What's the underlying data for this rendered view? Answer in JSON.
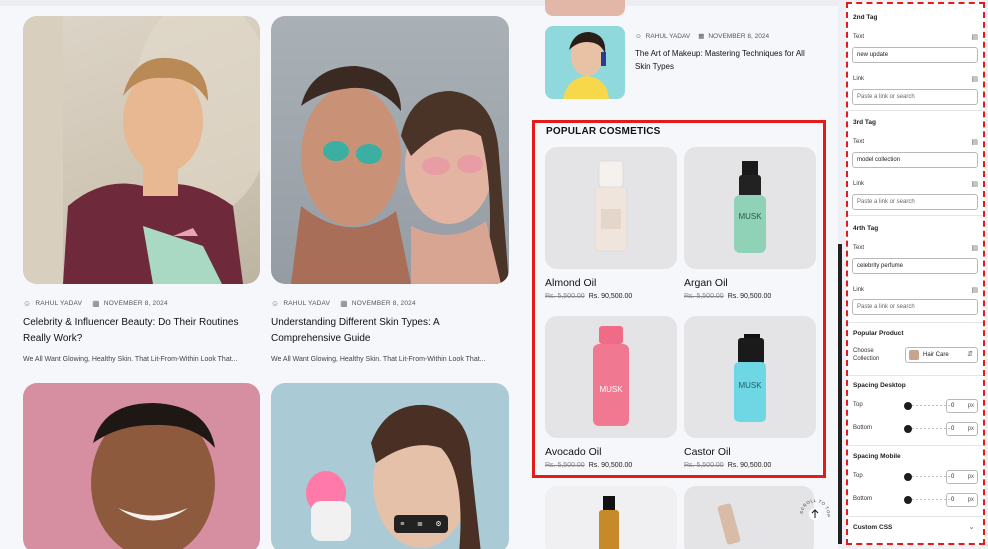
{
  "posts": [
    {
      "author": "RAHUL YADAV",
      "date": "NOVEMBER 8, 2024",
      "title": "Celebrity & Influencer Beauty: Do Their Routines Really Work?",
      "excerpt": "We All Want Glowing, Healthy Skin. That Lit-From-Within Look That..."
    },
    {
      "author": "RAHUL YADAV",
      "date": "NOVEMBER 8, 2024",
      "title": "Understanding Different Skin Types: A Comprehensive Guide",
      "excerpt": "We All Want Glowing, Healthy Skin. That Lit-From-Within Look That..."
    }
  ],
  "side_post": {
    "author": "RAHUL YADAV",
    "date": "NOVEMBER 8, 2024",
    "title": "The Art of Makeup: Mastering Techniques for All Skin Types"
  },
  "popular": {
    "heading": "POPULAR COSMETICS",
    "products": [
      {
        "name": "Almond Oil",
        "old_price": "Rs. 5,500.00",
        "price": "Rs. 90,500.00"
      },
      {
        "name": "Argan Oil",
        "old_price": "Rs. 5,500.00",
        "price": "Rs. 90,500.00"
      },
      {
        "name": "Avocado Oil",
        "old_price": "Rs. 5,500.00",
        "price": "Rs. 90,500.00"
      },
      {
        "name": "Castor Oil",
        "old_price": "Rs. 5,500.00",
        "price": "Rs. 90,500.00"
      }
    ],
    "bottle_label": "MUSK"
  },
  "scroll_top": {
    "text": "SCROLL TO TOP"
  },
  "panel": {
    "tag2": {
      "heading": "2nd Tag",
      "text_label": "Text",
      "text_value": "new update",
      "link_label": "Link",
      "link_placeholder": "Paste a link or search"
    },
    "tag3": {
      "heading": "3rd Tag",
      "text_label": "Text",
      "text_value": "model collection",
      "link_label": "Link",
      "link_placeholder": "Paste a link or search"
    },
    "tag4": {
      "heading": "4rth Tag",
      "text_label": "Text",
      "text_value": "celebrity perfume",
      "link_label": "Link",
      "link_placeholder": "Paste a link or search"
    },
    "popular_product": {
      "heading": "Popular Product",
      "choose_label_1": "Choose",
      "choose_label_2": "Collection",
      "selected": "Hair Care"
    },
    "spacing_desktop": {
      "heading": "Spacing Desktop",
      "top_label": "Top",
      "top_value": "0",
      "bottom_label": "Bottom",
      "bottom_value": "0",
      "unit": "px"
    },
    "spacing_mobile": {
      "heading": "Spacing Mobile",
      "top_label": "Top",
      "top_value": "0",
      "bottom_label": "Bottom",
      "bottom_value": "0",
      "unit": "px"
    },
    "custom_css": {
      "heading": "Custom CSS"
    }
  },
  "colors": {
    "highlight": "#e41b1b",
    "page_bg": "#f6f7fb",
    "product_bg": "#e4e4e7"
  },
  "icons": [
    "user-icon",
    "calendar-icon",
    "database-icon",
    "chevron-down-icon",
    "arrow-up-icon"
  ]
}
